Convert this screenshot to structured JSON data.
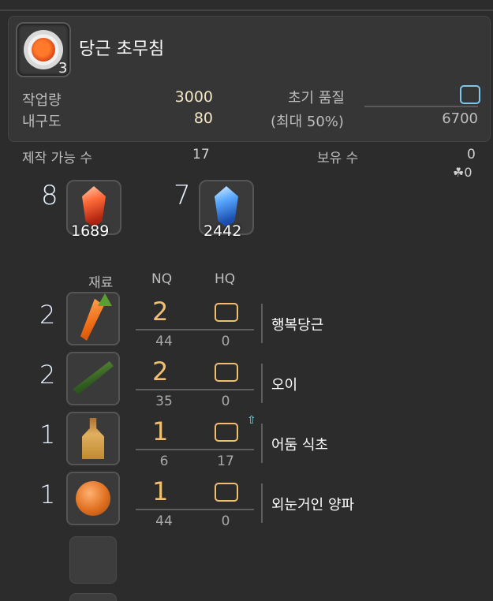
{
  "recipe": {
    "name": "당근 초무침",
    "yield": "3",
    "progress_label": "작업량",
    "progress_value": "3000",
    "durability_label": "내구도",
    "durability_value": "80",
    "initial_quality_label": "초기 품질",
    "max_label": "(최대 50%)",
    "quality_max": "6700"
  },
  "craftable": {
    "label": "제작 가능 수",
    "value": "17",
    "owned_label": "보유 수",
    "owned_value": "0",
    "owned_hq_value": "0"
  },
  "crystals": [
    {
      "required": "8",
      "stock": "1689",
      "icon": "fire-crystal-icon"
    },
    {
      "required": "7",
      "stock": "2442",
      "icon": "water-crystal-icon"
    }
  ],
  "columns": {
    "material": "재료",
    "nq": "NQ",
    "hq": "HQ"
  },
  "materials": [
    {
      "required": "2",
      "nq_used": "2",
      "hq_used": "0",
      "nq_have": "44",
      "hq_have": "0",
      "name": "행복당근",
      "icon": "carrot-icon"
    },
    {
      "required": "2",
      "nq_used": "2",
      "hq_used": "0",
      "nq_have": "35",
      "hq_have": "0",
      "name": "오이",
      "icon": "cucumber-icon"
    },
    {
      "required": "1",
      "nq_used": "1",
      "hq_used": "0",
      "nq_have": "6",
      "hq_have": "17",
      "name": "어둠 식초",
      "icon": "vinegar-bottle-icon"
    },
    {
      "required": "1",
      "nq_used": "1",
      "hq_used": "0",
      "nq_have": "44",
      "hq_have": "0",
      "name": "외눈거인 양파",
      "icon": "onion-icon"
    }
  ],
  "colors": {
    "nq_accent": "#f0c070",
    "quality_box": "#7cc9f0",
    "hq_arrow": "#6fe0f0"
  }
}
